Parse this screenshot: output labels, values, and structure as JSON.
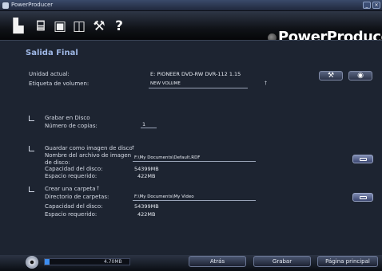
{
  "window": {
    "title": "PowerProducer"
  },
  "toolbar": {
    "brand": "PowerProducer"
  },
  "page": {
    "title": "Salida Final"
  },
  "drive": {
    "label": "Unidad actual:",
    "value": "E: PIONEER DVD-RW DVR-112 1.15"
  },
  "volume": {
    "label": "Etiqueta de volumen:",
    "value": "NEW VOLUME"
  },
  "burn": {
    "label": "Grabar en Disco",
    "copies_label": "Número de copias:",
    "copies_value": "1"
  },
  "image": {
    "label": "Guardar como imagen de disco",
    "file_label": "Nombre del archivo de imagen de disco:",
    "file_value": "F:\\My Documents\\Default.RDF",
    "capacity_label": "Capacidad del disco:",
    "capacity_value": "54399MB",
    "required_label": "Espacio requerido:",
    "required_value": "422MB"
  },
  "folder": {
    "label": "Crear una carpeta",
    "dir_label": "Directorio de carpetas:",
    "dir_value": "F:\\My Documents\\My Video",
    "capacity_label": "Capacidad del disco:",
    "capacity_value": "54399MB",
    "required_label": "Espacio requerido:",
    "required_value": "422MB"
  },
  "footer": {
    "capacity": "4.70MB",
    "capacity_fill": 0.06,
    "back": "Atrás",
    "record": "Grabar",
    "home": "Página principal"
  },
  "colors": {
    "accent": "#3d8ef0",
    "panel": "#1d2431",
    "title": "#9fb8e6"
  }
}
